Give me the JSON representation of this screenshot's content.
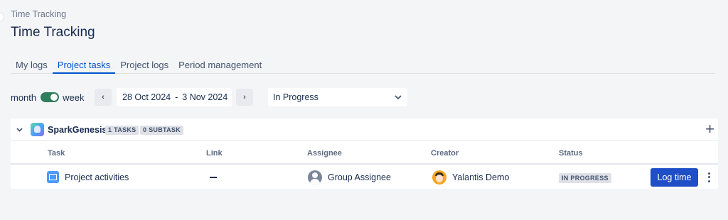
{
  "breadcrumb": "Time Tracking",
  "page_title": "Time Tracking",
  "tabs": [
    {
      "label": "My logs"
    },
    {
      "label": "Project tasks"
    },
    {
      "label": "Project logs"
    },
    {
      "label": "Period management"
    }
  ],
  "controls": {
    "month_label": "month",
    "week_label": "week",
    "toggle_selected": "week",
    "prev_glyph": "‹",
    "next_glyph": "›",
    "date_start": "28 Oct 2024",
    "date_separator": "-",
    "date_end": "3 Nov 2024",
    "status_filter": "In Progress"
  },
  "project": {
    "name": "SparkGenesis",
    "tasks_badge": "1 TASKS",
    "subtask_badge": "0 SUBTASK",
    "add_glyph": "+"
  },
  "table": {
    "columns": [
      "Task",
      "Link",
      "Assignee",
      "Creator",
      "Status"
    ],
    "rows": [
      {
        "task": "Project activities",
        "link": "—",
        "assignee": "Group Assignee",
        "creator": "Yalantis Demo",
        "status": "IN PROGRESS",
        "action": "Log time"
      }
    ]
  },
  "colors": {
    "accent": "#0052cc",
    "button": "#1f4fc6",
    "toggle_on": "#2e7d5b",
    "background": "#f4f5f7"
  }
}
